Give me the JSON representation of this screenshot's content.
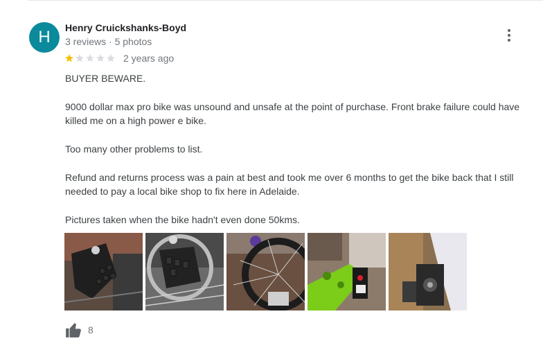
{
  "review": {
    "avatar_letter": "H",
    "avatar_color": "#0b8a9c",
    "author": "Henry Cruickshanks-Boyd",
    "author_meta": "3 reviews · 5 photos",
    "rating": 1,
    "rating_max": 5,
    "time": "2 years ago",
    "paragraphs": [
      "BUYER BEWARE.",
      "9000 dollar max pro bike was unsound and unsafe at the point of purchase.  Front brake failure could have killed me on a high power e bike.",
      "Too many other problems to list.",
      "Refund and returns process was a pain at best and took me over 6 months to get the bike back that I still needed to pay a local bike shop to fix here in Adelaide.",
      "Pictures taken when the bike hadn't even done 50kms."
    ],
    "photos": [
      {
        "subject": "brake caliper close-up"
      },
      {
        "subject": "disc brake rotor and pads"
      },
      {
        "subject": "front wheel and fork"
      },
      {
        "subject": "green frame and shock"
      },
      {
        "subject": "rear caliper mount"
      }
    ],
    "likes": "8",
    "star_filled_color": "#fbbc04",
    "star_empty_color": "#dadce0"
  }
}
